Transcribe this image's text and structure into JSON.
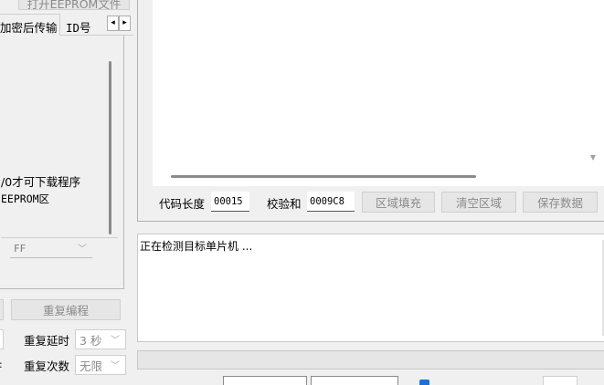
{
  "top_button": {
    "label": "打开EEPROM文件"
  },
  "tabs": [
    {
      "label": "加密后传输"
    },
    {
      "label": "ID号"
    }
  ],
  "tab_scroll": {
    "left_icon": "◂",
    "right_icon": "▸"
  },
  "options_panel": {
    "text_line1": "/0才可下载程序",
    "text_line2": "EEPROM区",
    "value_select": {
      "value": "FF"
    }
  },
  "left_actions": {
    "repeat_program_label": "重复编程",
    "repeat_delay": {
      "label": "重复延时",
      "value": "3 秒"
    },
    "repeat_count": {
      "label": "重复次数",
      "value": "无限"
    }
  },
  "code_panel": {
    "code_length_label": "代码长度",
    "code_length_value": "00015",
    "checksum_label": "校验和",
    "checksum_value": "0009C8",
    "fill_area_button": "区域填充",
    "clear_area_button": "清空区域",
    "save_data_button": "保存数据"
  },
  "log": {
    "text": "正在检测目标单片机 ..."
  },
  "progress": {
    "value": 0
  },
  "colors": {
    "checkbox_blue": "#1e6fd9",
    "scroll_gray": "#a0a0a0"
  }
}
